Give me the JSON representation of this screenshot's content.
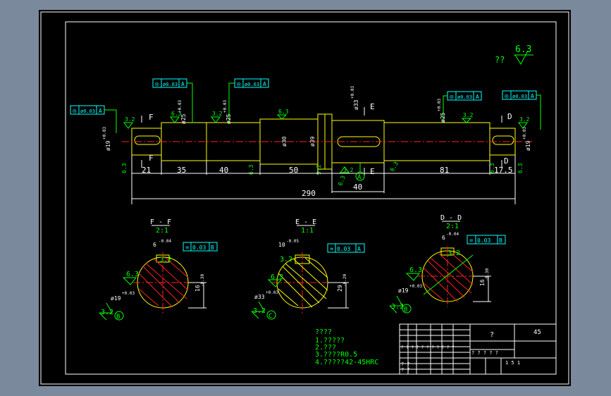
{
  "colors": {
    "background": "#000000",
    "frame": "#ffffff",
    "outline": "#ffff00",
    "dimension": "#ffffff",
    "annotation": "#00ff00",
    "tolerance": "#00ffff",
    "centerline": "#ff2020"
  },
  "roughness_general": {
    "prefix": "??",
    "value": "6.3"
  },
  "tolerance_frames": {
    "f_left_1": {
      "symbol": "◎",
      "value": "ø0.03",
      "datum": "A"
    },
    "f_left_2": {
      "symbol": "◎",
      "value": "ø0.03",
      "datum": "A"
    },
    "f_left_3": {
      "symbol": "◎",
      "value": "ø0.03",
      "datum": "A"
    },
    "f_right_1": {
      "symbol": "◎",
      "value": "ø0.03",
      "datum": "A"
    },
    "f_right_2": {
      "symbol": "◎",
      "value": "ø0.03",
      "datum": "A"
    },
    "f_ff": {
      "symbol": "=",
      "value": "0.03",
      "datum": "B"
    },
    "f_ee": {
      "symbol": "=",
      "value": "0.03",
      "datum": "A"
    },
    "f_dd": {
      "symbol": "=",
      "value": "0.03",
      "datum": "B"
    }
  },
  "section_labels": {
    "F_top": "F",
    "F_bot": "F",
    "E_top": "E",
    "E_bot": "E",
    "D_top": "D",
    "D_bot": "D"
  },
  "diameters": {
    "d_left_end": "ø19",
    "d_left_end_tol": "+0.03",
    "d_25_left": "ø25",
    "d_25_left_tol": "+0.03",
    "d_25b": "ø25",
    "d_25b_tol": "+0.03",
    "d_30": "ø30",
    "d_39": "ø39",
    "d_33": "ø33",
    "d_33_tol": "+0.03",
    "d_25_right": "ø25",
    "d_25_right_tol": "+0.03",
    "d_right_end": "ø19",
    "d_right_end_tol": "+0.03"
  },
  "roughness_marks": {
    "r1": "3.2",
    "r2": "6.3",
    "r3": "3.2",
    "r4": "6.3",
    "r5": "3.2",
    "r6": "3.2",
    "r7": "3.2",
    "r8": "6.3",
    "r9": "6.3",
    "r10": "3.2",
    "r11": "6.3",
    "r12": "6.3",
    "r13": "6.3",
    "r14": "6.3"
  },
  "lengths": {
    "l21": "21",
    "l35": "35",
    "l40a": "40",
    "l50": "50",
    "l40b": "40",
    "l81": "81",
    "l17": "17.5",
    "total": "290"
  },
  "datum_shaft": "A",
  "sections": {
    "ff": {
      "title": "F - F",
      "scale": "2:1",
      "keyway": "6",
      "keyway_tol": "-0.04",
      "depth": "16",
      "depth_tol": "-0.30",
      "dia": "ø19",
      "dia_tol": "+0.03",
      "rough1": "3.2",
      "rough2": "6.3",
      "rough3": "3.2",
      "datum": "B"
    },
    "ee": {
      "title": "E - E",
      "scale": "1:1",
      "keyway": "10",
      "keyway_tol": "-0.05",
      "depth": "29",
      "depth_tol": "-0.20",
      "dia": "ø33",
      "dia_tol": "+0.03",
      "rough1": "3.2",
      "rough2": "6.3",
      "rough3": "3.2",
      "datum": "C"
    },
    "dd": {
      "title": "D - D",
      "scale": "2:1",
      "keyway": "6",
      "keyway_tol": "-0.04",
      "depth": "16",
      "depth_tol": "-0.30",
      "dia": "ø19",
      "dia_tol": "+0.03",
      "rough1": "3.2",
      "rough2": "6.3",
      "rough3": "3.2",
      "datum": "B"
    }
  },
  "notes": {
    "title": "????",
    "line1": "1.?????",
    "line2": "2.???",
    "line3": "3.????R0.5",
    "line4": "4.?????42-45HRC"
  },
  "title_block": {
    "part_name": "?",
    "material": "45",
    "row_text_a": "? ? ? ? ? ? ? ? ? ? ?",
    "row_text_b": "? ? ? ? ?",
    "scale_text": "1 5 1",
    "mark_a": "? ?",
    "mark_b": "? ?"
  }
}
